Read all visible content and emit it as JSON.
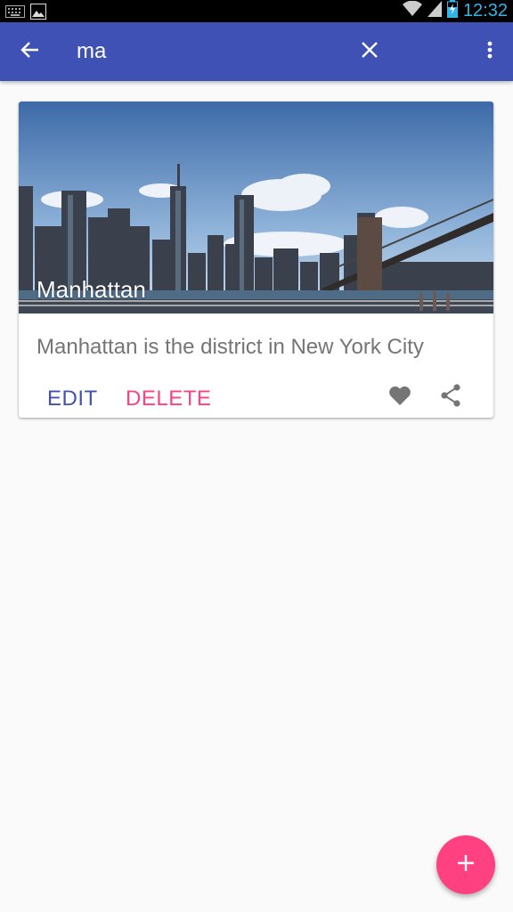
{
  "status_bar": {
    "time": "12:32",
    "icons": [
      "keyboard-icon",
      "image-icon",
      "wifi-icon",
      "signal-icon",
      "battery-charging-icon"
    ]
  },
  "app_bar": {
    "search_value": "ma",
    "back_icon": "arrow-back-icon",
    "clear_icon": "close-icon",
    "more_icon": "more-vert-icon",
    "color": "#3f51b5"
  },
  "card": {
    "image": "manhattan-skyline-photo",
    "title": "Manhattan",
    "description": "Manhattan is the district in New York City",
    "actions": {
      "edit_label": "EDIT",
      "delete_label": "DELETE",
      "favorite_icon": "heart-icon",
      "share_icon": "share-icon"
    }
  },
  "fab": {
    "icon": "add-icon",
    "color": "#ff4081"
  }
}
